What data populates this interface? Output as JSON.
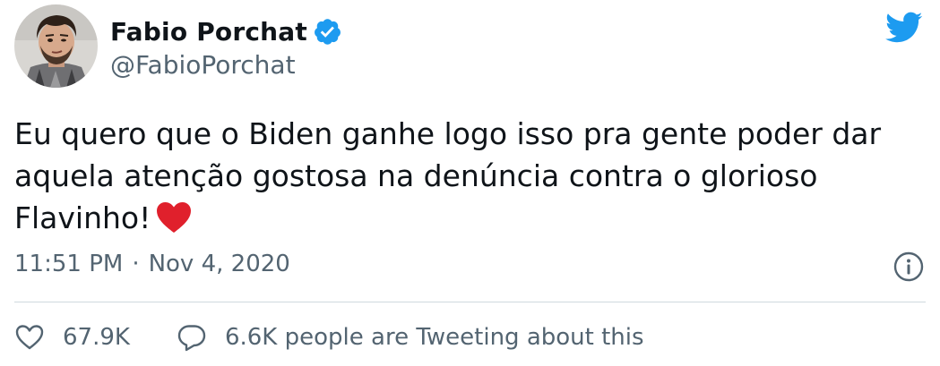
{
  "user": {
    "display_name": "Fabio Porchat",
    "handle": "@FabioPorchat",
    "verified": true
  },
  "tweet": {
    "text": "Eu quero que o Biden ganhe logo isso pra gente poder dar aquela atenção gostosa na denúncia contra o glorioso Flavinho!",
    "time": "11:51 PM",
    "separator": "·",
    "date": "Nov 4, 2020"
  },
  "actions": {
    "likes": "67.9K",
    "conversation": "6.6K people are Tweeting about this"
  },
  "colors": {
    "brand_blue": "#1d9bf0",
    "heart_red": "#e0202c",
    "secondary_text": "#536471"
  },
  "icons": [
    "avatar",
    "verified-badge-icon",
    "twitter-bird-icon",
    "red-heart-emoji",
    "info-icon",
    "heart-outline-icon",
    "speech-bubble-icon"
  ]
}
